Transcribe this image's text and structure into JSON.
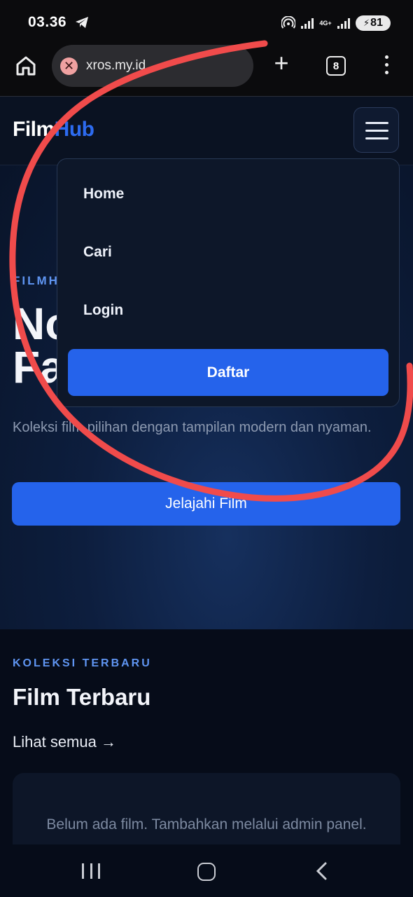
{
  "status_bar": {
    "time": "03.36",
    "network": "4G+",
    "battery": "81"
  },
  "browser": {
    "url": "xros.my.id",
    "tab_count": "8",
    "new_tab": "+"
  },
  "site": {
    "logo_part1": "Film",
    "logo_part2": "Hub"
  },
  "menu": {
    "items": [
      {
        "label": "Home"
      },
      {
        "label": "Cari"
      },
      {
        "label": "Login"
      }
    ],
    "register_label": "Daftar"
  },
  "hero": {
    "eyebrow": "FILMH",
    "title_line1": "No",
    "title_line2": "Fa",
    "description": "Koleksi film pilihan dengan tampilan modern dan nyaman.",
    "button_label": "Jelajahi Film"
  },
  "latest": {
    "eyebrow": "KOLEKSI TERBARU",
    "title": "Film Terbaru",
    "see_all": "Lihat semua →",
    "empty_message": "Belum ada film. Tambahkan melalui admin panel."
  },
  "colors": {
    "accent": "#2563eb",
    "eyebrow": "#5f95f2",
    "annotation": "#f04b4b"
  },
  "icons": [
    "telegram-icon",
    "hotspot-icon",
    "signal-icon",
    "battery-icon",
    "home-icon",
    "close-icon",
    "plus-icon",
    "tabs-icon",
    "more-vert-icon",
    "hamburger-icon",
    "recent-apps-icon",
    "home-circle-icon",
    "back-icon"
  ]
}
